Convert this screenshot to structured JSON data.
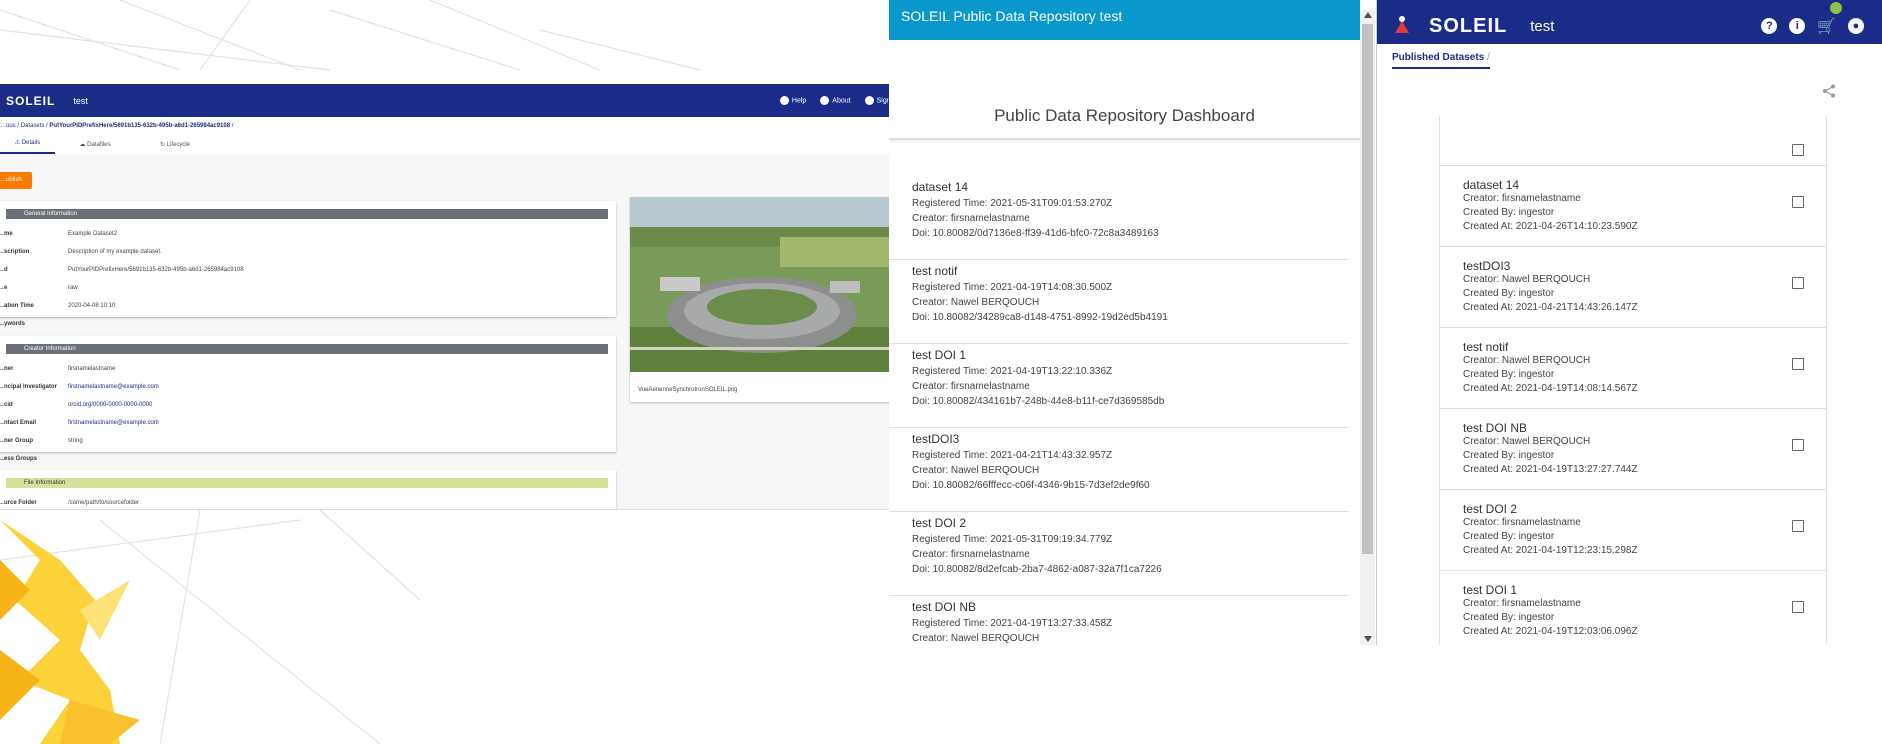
{
  "colors": {
    "navy": "#1b2c88",
    "cyan_bar": "#0a97cc",
    "orange": "#f57c00",
    "section_gray": "#6b6f78",
    "section_green": "#d4e39a"
  },
  "panel_details": {
    "logo": "SOLEIL",
    "nav_title": "test",
    "nav_help": "Help",
    "nav_about": "About",
    "nav_signin": "Sign in",
    "crumb_start": "…ous",
    "crumb_datasets": "Datasets",
    "crumb_current": "PutYourPIDPrefixHere/5691b135-632b-495b-a6d1-265984ac9108",
    "tabs": [
      "Details",
      "Datafiles",
      "Lifecycle"
    ],
    "publish_label": "…ublish",
    "general_title": "General Information",
    "general_rows": [
      {
        "k": "…me",
        "v": "Example Dataset2"
      },
      {
        "k": "…scription",
        "v": "Description of my example dataset."
      },
      {
        "k": "…d",
        "v": "PutYourPIDPrefixHere/5691b135-632b-495b-a6d1-265984ac9108"
      },
      {
        "k": "…e",
        "v": "raw"
      },
      {
        "k": "…ation Time",
        "v": "2020-04-08 10:10"
      },
      {
        "k": "…ywords",
        "v": ""
      }
    ],
    "creator_title": "Creator Information",
    "creator_rows": [
      {
        "k": "…ner",
        "v": "firsnamelastname"
      },
      {
        "k": "…ncipal Investigator",
        "v": "firstnamelastname@example.com"
      },
      {
        "k": "…cid",
        "v": "orcid.org/0000-0000-0000-0000"
      },
      {
        "k": "…ntact Email",
        "v": "firstnamelastname@example.com"
      },
      {
        "k": "…ner Group",
        "v": "string"
      },
      {
        "k": "…ess Groups",
        "v": ""
      }
    ],
    "file_title": "File Information",
    "file_rows": [
      {
        "k": "…urce Folder",
        "v": "/some/path/to/sourcefolder"
      }
    ],
    "image_caption": "VueAerienneSynchrotronSOLEIL.png"
  },
  "panel_dashboard": {
    "bar_title": "SOLEIL Public Data Repository test",
    "heading": "Public Data Repository Dashboard",
    "items": [
      {
        "title": "dataset 14",
        "reg": "Registered Time: 2021-05-31T09:01:53.270Z",
        "creator": "Creator: firsnamelastname",
        "doi": "Doi: 10.80082/0d7136e8-ff39-41d6-bfc0-72c8a3489163"
      },
      {
        "title": "test notif",
        "reg": "Registered Time: 2021-04-19T14:08:30.500Z",
        "creator": "Creator: Nawel BERQOUCH",
        "doi": "Doi: 10.80082/34289ca8-d148-4751-8992-19d2ed5b4191"
      },
      {
        "title": "test DOI 1",
        "reg": "Registered Time: 2021-04-19T13:22:10.336Z",
        "creator": "Creator: firsnamelastname",
        "doi": "Doi: 10.80082/434161b7-248b-44e8-b11f-ce7d369585db"
      },
      {
        "title": "testDOI3",
        "reg": "Registered Time: 2021-04-21T14:43:32.957Z",
        "creator": "Creator: Nawel BERQOUCH",
        "doi": "Doi: 10.80082/66fffecc-c06f-4346-9b15-7d3ef2de9f60"
      },
      {
        "title": "test DOI 2",
        "reg": "Registered Time: 2021-05-31T09:19:34.779Z",
        "creator": "Creator: firsnamelastname",
        "doi": "Doi: 10.80082/8d2efcab-2ba7-4862-a087-32a7f1ca7226"
      },
      {
        "title": "test DOI NB",
        "reg": "Registered Time: 2021-04-19T13:27:33.458Z",
        "creator": "Creator: Nawel BERQOUCH",
        "doi": ""
      }
    ]
  },
  "panel_published": {
    "logo": "SOLEIL",
    "nav_title": "test",
    "crumb": "Published Datasets",
    "rows": [
      {
        "title": "dataset 14",
        "creator": "Creator: firsnamelastname",
        "by": "Created By: ingestor",
        "at": "Created At: 2021-04-26T14:10:23.590Z"
      },
      {
        "title": "testDOI3",
        "creator": "Creator: Nawel BERQOUCH",
        "by": "Created By: ingestor",
        "at": "Created At: 2021-04-21T14:43:26.147Z"
      },
      {
        "title": "test notif",
        "creator": "Creator: Nawel BERQOUCH",
        "by": "Created By: ingestor",
        "at": "Created At: 2021-04-19T14:08:14.567Z"
      },
      {
        "title": "test DOI NB",
        "creator": "Creator: Nawel BERQOUCH",
        "by": "Created By: ingestor",
        "at": "Created At: 2021-04-19T13:27:27.744Z"
      },
      {
        "title": "test DOI 2",
        "creator": "Creator: firsnamelastname",
        "by": "Created By: ingestor",
        "at": "Created At: 2021-04-19T12:23:15.298Z"
      },
      {
        "title": "test DOI 1",
        "creator": "Creator: firsnamelastname",
        "by": "Created By: ingestor",
        "at": "Created At: 2021-04-19T12:03:06.096Z"
      }
    ]
  }
}
